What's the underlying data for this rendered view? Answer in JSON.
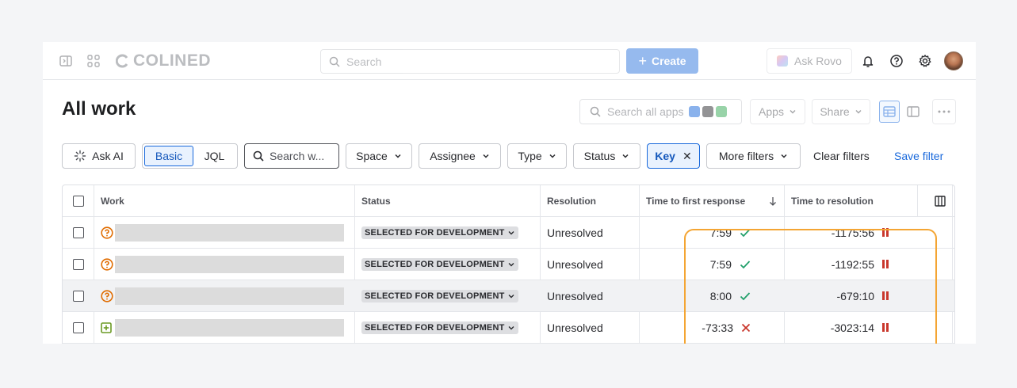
{
  "topbar": {
    "logo_text": "COLINED",
    "search_placeholder": "Search",
    "create_label": "Create",
    "rovo_label": "Ask Rovo"
  },
  "header": {
    "title": "All work",
    "search_apps_placeholder": "Search all apps",
    "apps_label": "Apps",
    "share_label": "Share"
  },
  "filters": {
    "ask_ai_label": "Ask AI",
    "basic_label": "Basic",
    "jql_label": "JQL",
    "search_placeholder": "Search w...",
    "space_label": "Space",
    "assignee_label": "Assignee",
    "type_label": "Type",
    "status_label": "Status",
    "key_label": "Key",
    "more_filters_label": "More filters",
    "clear_filters_label": "Clear filters",
    "save_filter_label": "Save filter"
  },
  "table": {
    "columns": {
      "work": "Work",
      "status": "Status",
      "resolution": "Resolution",
      "first_response": "Time to first response",
      "time_to_resolution": "Time to resolution"
    },
    "rows": [
      {
        "type_icon": "question-icon",
        "status": "SELECTED FOR DEVELOPMENT",
        "resolution": "Unresolved",
        "first_response": "7:59",
        "first_response_met": true,
        "time_to_resolution": "-1175:56",
        "resolution_paused": true
      },
      {
        "type_icon": "question-icon",
        "status": "SELECTED FOR DEVELOPMENT",
        "resolution": "Unresolved",
        "first_response": "7:59",
        "first_response_met": true,
        "time_to_resolution": "-1192:55",
        "resolution_paused": true
      },
      {
        "type_icon": "question-icon",
        "status": "SELECTED FOR DEVELOPMENT",
        "resolution": "Unresolved",
        "first_response": "8:00",
        "first_response_met": true,
        "time_to_resolution": "-679:10",
        "resolution_paused": true
      },
      {
        "type_icon": "plus-square-icon",
        "status": "SELECTED FOR DEVELOPMENT",
        "resolution": "Unresolved",
        "first_response": "-73:33",
        "first_response_met": false,
        "time_to_resolution": "-3023:14",
        "resolution_paused": true
      }
    ]
  },
  "colors": {
    "accent": "#1868db",
    "check": "#22a06b",
    "cross": "#c9372c",
    "highlight": "#f4a533",
    "question_icon": "#e06c00",
    "story_icon": "#6a9a23"
  }
}
